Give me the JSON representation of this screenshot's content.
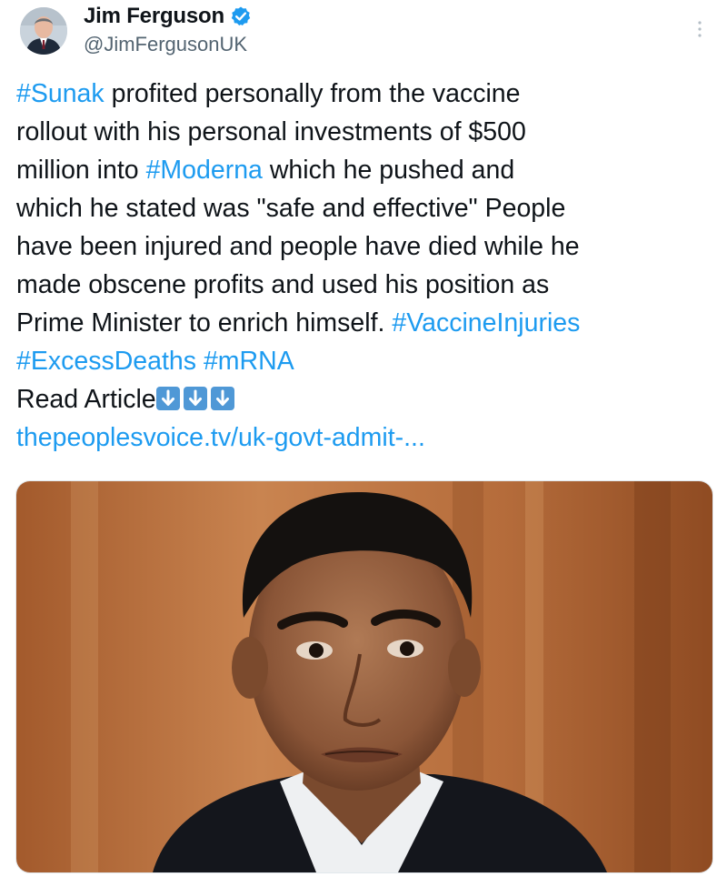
{
  "author": {
    "display_name": "Jim Ferguson",
    "handle": "@JimFergusonUK",
    "verified": true,
    "avatar_icon": "person-avatar-icon"
  },
  "menu_icon": "more-options-icon",
  "tweet": {
    "line1_tag": "#Sunak",
    "line1_text": " profited personally from the vaccine",
    "line2_text": "rollout with his personal investments of $500",
    "line3_text_a": "million into ",
    "line3_tag": "#Moderna",
    "line3_text_b": " which he pushed and",
    "line4_text": "which he stated was \"safe and effective\" People",
    "line5_text": "have been injured and people have died while he",
    "line6_text": "made obscene profits and used his position as",
    "line7_text": "Prime Minister to enrich himself. ",
    "line7_tag": "#VaccineInjuries",
    "line8_tag_a": "#ExcessDeaths",
    "line8_space": " ",
    "line8_tag_b": "#mRNA",
    "read_article": "Read Article",
    "arrows_icon": "down-arrow-emoji-icon",
    "link_text": "thepeoplesvoice.tv/uk-govt-admit-..."
  },
  "media": {
    "type": "photo",
    "subject": "man-in-suit-photo"
  },
  "colors": {
    "link_blue": "#1d9bf0",
    "verified_blue": "#1d9bf0",
    "handle_gray": "#536471",
    "text": "#0f1419"
  }
}
